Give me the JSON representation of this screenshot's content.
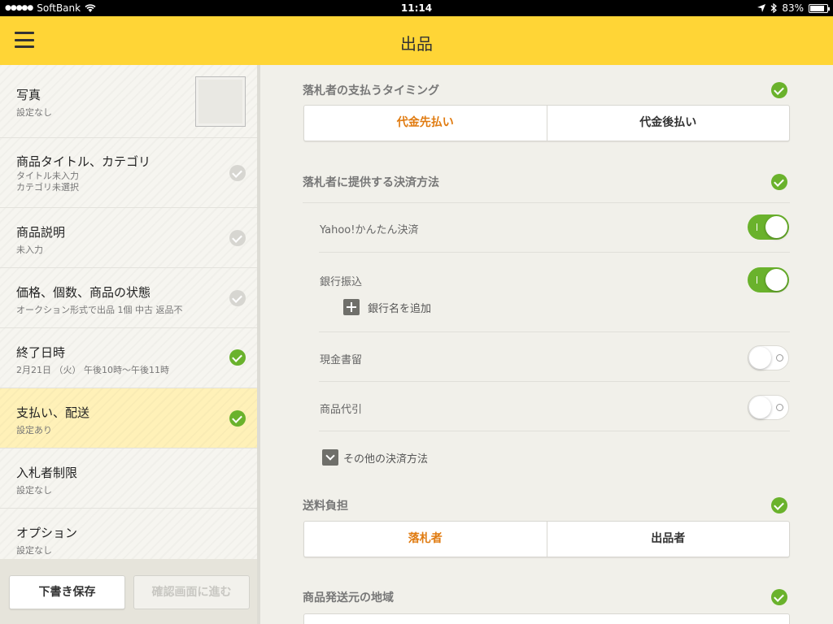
{
  "status_bar": {
    "carrier": "SoftBank",
    "time": "11:14",
    "battery": "83%",
    "battery_level": 0.83
  },
  "header": {
    "title": "出品"
  },
  "sidebar": {
    "items": [
      {
        "title": "写真",
        "sub": "設定なし"
      },
      {
        "title": "商品タイトル、カテゴリ",
        "sub": "タイトル未入力",
        "sub2": "カテゴリ未選択"
      },
      {
        "title": "商品説明",
        "sub": "未入力"
      },
      {
        "title": "価格、個数、商品の状態",
        "sub": "オークション形式で出品 1個  中古 返品不"
      },
      {
        "title": "終了日時",
        "sub": " 2月21日 （火） 午後10時〜午後11時"
      },
      {
        "title": "支払い、配送",
        "sub": "設定あり"
      },
      {
        "title": "入札者制限",
        "sub": "設定なし"
      },
      {
        "title": "オプション",
        "sub": "設定なし"
      }
    ],
    "save_draft": "下書き保存",
    "confirm": "確認画面に進む"
  },
  "main": {
    "payment_timing": {
      "title": "落札者の支払うタイミング",
      "options": [
        "代金先払い",
        "代金後払い"
      ],
      "selected": "代金先払い"
    },
    "payment_methods": {
      "title": "落札者に提供する決済方法",
      "yahoo": "Yahoo!かんたん決済",
      "bank": "銀行振込",
      "add_bank": "銀行名を追加",
      "cash_registered": "現金書留",
      "cod": "商品代引",
      "other": "その他の決済方法"
    },
    "shipping_fee": {
      "title": "送料負担",
      "options": [
        "落札者",
        "出品者"
      ],
      "selected": "落札者"
    },
    "ship_from": {
      "title": "商品発送元の地域"
    }
  },
  "colors": {
    "header": "#ffd536",
    "accent_orange": "#e07b10",
    "check_green": "#6ab22c",
    "active_item": "#fff1b8"
  }
}
